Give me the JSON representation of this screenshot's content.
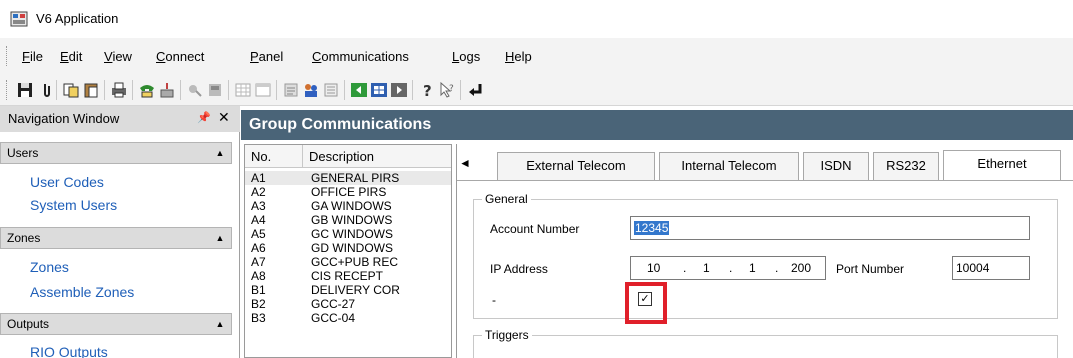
{
  "window": {
    "title": "V6 Application"
  },
  "menu": [
    {
      "key": "F",
      "rest": "ile"
    },
    {
      "key": "E",
      "rest": "dit"
    },
    {
      "key": "V",
      "rest": "iew"
    },
    {
      "key": "C",
      "rest": "onnect"
    },
    {
      "key": "P",
      "rest": "anel"
    },
    {
      "key": "C",
      "rest": "ommunications"
    },
    {
      "key": "L",
      "rest": "ogs"
    },
    {
      "key": "H",
      "rest": "elp"
    }
  ],
  "navigation": {
    "title": "Navigation Window",
    "pin_glyph": "\u0004",
    "close_glyph": "✕",
    "groups": [
      {
        "label": "Users",
        "links": [
          "User Codes",
          "System Users"
        ]
      },
      {
        "label": "Zones",
        "links": [
          "Zones",
          "Assemble Zones"
        ]
      },
      {
        "label": "Outputs",
        "links": [
          "RIO Outputs"
        ]
      }
    ]
  },
  "group_comms": {
    "title": "Group Communications",
    "list": {
      "col_no": "No.",
      "col_desc": "Description",
      "rows": [
        {
          "no": "A1",
          "desc": "GENERAL PIRS"
        },
        {
          "no": "A2",
          "desc": "OFFICE PIRS"
        },
        {
          "no": "A3",
          "desc": "GA WINDOWS"
        },
        {
          "no": "A4",
          "desc": "GB WINDOWS"
        },
        {
          "no": "A5",
          "desc": "GC WINDOWS"
        },
        {
          "no": "A6",
          "desc": "GD WINDOWS"
        },
        {
          "no": "A7",
          "desc": "GCC+PUB REC"
        },
        {
          "no": "A8",
          "desc": "CIS RECEPT"
        },
        {
          "no": "B1",
          "desc": "DELIVERY COR"
        },
        {
          "no": "B2",
          "desc": "GCC-27"
        },
        {
          "no": "B3",
          "desc": "GCC-04"
        }
      ]
    },
    "tabs": [
      "External Telecom",
      "Internal Telecom",
      "ISDN",
      "RS232",
      "Ethernet"
    ],
    "active_tab": "Ethernet",
    "general": {
      "legend": "General",
      "account_label": "Account Number",
      "account_value": "12345",
      "ip_label": "IP Address",
      "ip": [
        "10",
        "1",
        "1",
        "200"
      ],
      "port_label": "Port Number",
      "port_value": "10004",
      "checkbox_label": "-",
      "checkbox_checked": "✓"
    },
    "triggers": {
      "legend": "Triggers"
    }
  },
  "colors": {
    "header_bg": "#4a6478",
    "link": "#1f5fb8",
    "highlight": "#e0202a",
    "selection": "#3377cc"
  }
}
